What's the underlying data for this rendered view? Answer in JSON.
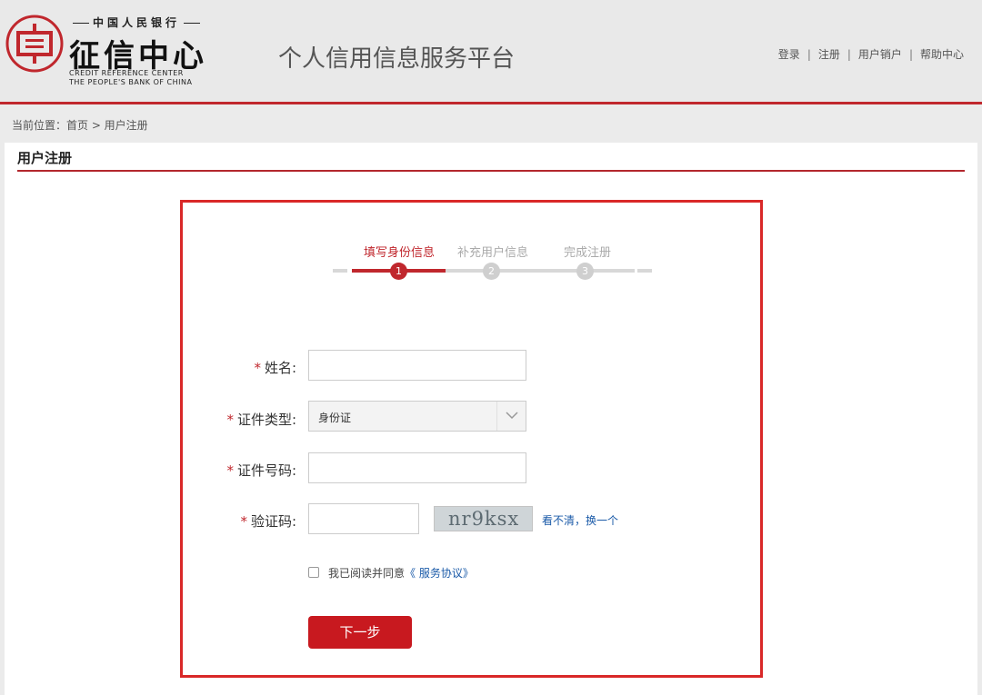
{
  "header": {
    "logo_bank_cn": "中国人民银行",
    "logo_title": "征信中心",
    "logo_en_line1": "CREDIT REFERENCE  CENTER",
    "logo_en_line2": "THE PEOPLE'S BANK OF CHINA",
    "platform_title": "个人信用信息服务平台",
    "nav": [
      "登录",
      "注册",
      "用户销户",
      "帮助中心"
    ],
    "nav_separator": "|",
    "brand_color": "#c0272d"
  },
  "breadcrumb": "当前位置：首页 > 用户注册",
  "page_title": "用户注册",
  "steps": [
    {
      "label": "填写身份信息",
      "number": "1",
      "state": "active"
    },
    {
      "label": "补充用户信息",
      "number": "2",
      "state": "inactive"
    },
    {
      "label": "完成注册",
      "number": "3",
      "state": "inactive"
    }
  ],
  "form": {
    "required_mark": "*",
    "name_label": "姓名:",
    "name_value": "",
    "id_type_label": "证件类型:",
    "id_type_selected": "身份证",
    "id_number_label": "证件号码:",
    "id_number_value": "",
    "captcha_label": "验证码:",
    "captcha_value": "",
    "captcha_image_text": "nr9ksx",
    "captcha_refresh": "看不清，换一个",
    "agree_prefix": "我已阅读并同意",
    "agree_link": "《 服务协议》",
    "agree_checked": false,
    "next_button": "下一步"
  }
}
